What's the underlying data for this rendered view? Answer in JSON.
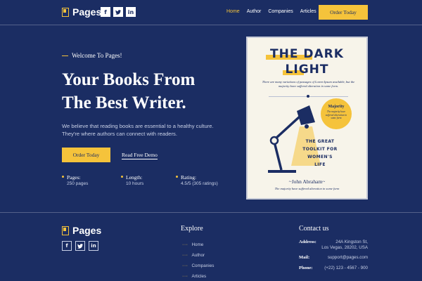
{
  "header": {
    "logo_text": "Pages",
    "socials": [
      "f",
      "t",
      "in"
    ],
    "nav": [
      {
        "label": "Home",
        "active": true
      },
      {
        "label": "Author",
        "active": false
      },
      {
        "label": "Companies",
        "active": false
      },
      {
        "label": "Articles",
        "active": false
      }
    ],
    "order_label": "Order Today"
  },
  "hero": {
    "welcome": "Welcome To Pages!",
    "title_line1": "Your Books From",
    "title_line2": "The Best Writer.",
    "desc_line1": "We believe that reading books are essential to a healthy culture.",
    "desc_line2": "They're where authors can connect with readers.",
    "order_label": "Order Today",
    "demo_label": "Read Free Demo",
    "stats": [
      {
        "label": "Pages:",
        "value": "250 pages"
      },
      {
        "label": "Length:",
        "value": "10 hours"
      },
      {
        "label": "Rating:",
        "value": "4.5/5 (305 ratings)"
      }
    ]
  },
  "book": {
    "title_line1": "THE DARK",
    "title_line2": "LIGHT",
    "blurb": "There are many variations of passages of Lorem Ipsum available, but the majority have suffered alteration in some form.",
    "badge_title": "Majority",
    "badge_sub": "The majority have suffered alteration in some form",
    "toolkit_line1": "THE GREAT",
    "toolkit_line2": "TOOLKIT FOR",
    "toolkit_line3": "WOMEN'S",
    "toolkit_line4": "LIFE",
    "author": "~John Abraham~",
    "author_sub": "The majority have suffered alteration in some form"
  },
  "footer": {
    "logo_text": "Pages",
    "socials": [
      "f",
      "t",
      "in"
    ],
    "explore_heading": "Explore",
    "explore_items": [
      "Home",
      "Author",
      "Companies",
      "Articles"
    ],
    "contact_heading": "Contact us",
    "address_label": "Address:",
    "address_line1": "24A Kingston St,",
    "address_line2": "Los Vegas, 28202, USA",
    "mail_label": "Mail:",
    "mail_value": "support@pages.com",
    "phone_label": "Phone:",
    "phone_value": "(+22) 123 - 4567 - 900"
  },
  "colors": {
    "background": "#1b2d63",
    "accent": "#f5c33b",
    "cover": "#f7f4ea"
  }
}
